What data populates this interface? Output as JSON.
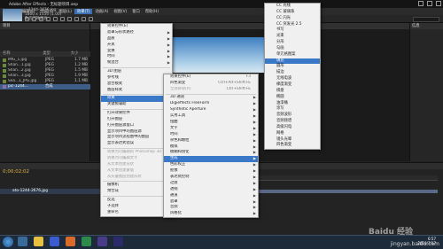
{
  "app": {
    "title": "Adobe After Effects - 无标题项目.aep",
    "menus": [
      "文件(F)",
      "编辑(E)",
      "合成(C)",
      "图层(L)",
      "效果(T)",
      "动画(A)",
      "视图(V)",
      "窗口",
      "帮助(H)"
    ],
    "active_menu": 4
  },
  "project": {
    "header": "项目",
    "info": [
      "...1244-2676.jpg",
      "1800 x 1150 (1.00)",
      "数百万种颜色"
    ],
    "columns": [
      "名称",
      "类型",
      "大小"
    ],
    "files": [
      {
        "name": "IMG_1.jpg",
        "type": "JPEG",
        "size": "1.7 MB"
      },
      {
        "name": "Shan...1.jpg",
        "type": "JPEG",
        "size": "1.2 MB"
      },
      {
        "name": "Shan...2.jpg",
        "type": "JPEG",
        "size": "1.5 MB"
      },
      {
        "name": "Shan...3.jpg",
        "type": "JPEG",
        "size": "1.9 MB"
      },
      {
        "name": "Sea...1_JPG.jpg",
        "type": "JPEG",
        "size": "1.1 MB"
      },
      {
        "name": "pic-1244...",
        "type": "合成",
        "size": ""
      }
    ]
  },
  "right_panel": {
    "header": "信息"
  },
  "timeline": {
    "timecode": "0;00;02;02",
    "layer": "ato-1244-2676.jpg"
  },
  "effect_menu": [
    {
      "label": "效果控件(E)",
      "arrow": false,
      "dis": false
    },
    {
      "label": "遮罩与形状路径",
      "arrow": true
    },
    {
      "label": "品质",
      "arrow": true
    },
    {
      "label": "开关",
      "arrow": true
    },
    {
      "label": "变换",
      "arrow": true
    },
    {
      "label": "时间",
      "arrow": true
    },
    {
      "label": "帧混合",
      "arrow": true
    },
    {
      "sep": true
    },
    {
      "label": "3D 图层",
      "arrow": false
    },
    {
      "label": "参考线",
      "arrow": false
    },
    {
      "label": "混合模式",
      "arrow": true
    },
    {
      "label": "图层样式",
      "arrow": true
    },
    {
      "sep": true
    },
    {
      "label": "效果",
      "arrow": true,
      "hl": true
    },
    {
      "label": "关键帧辅助",
      "arrow": true
    },
    {
      "sep": true
    },
    {
      "label": "打开效果控件",
      "arrow": false
    },
    {
      "label": "打开图层",
      "arrow": false
    },
    {
      "label": "打开图层源窗口",
      "arrow": false
    },
    {
      "label": "显示项目中的图层源",
      "arrow": false
    },
    {
      "label": "显示项目流程图中的图层",
      "arrow": false
    },
    {
      "label": "显示表达式错误",
      "arrow": false
    },
    {
      "sep": true
    },
    {
      "label": "转换为可编辑的 Photoshop 3D",
      "arrow": false,
      "dis": true
    },
    {
      "label": "转换为可编辑文字",
      "arrow": false,
      "dis": true
    },
    {
      "label": "从文本创建形状",
      "arrow": false,
      "dis": true
    },
    {
      "label": "从文本创建蒙版",
      "arrow": false,
      "dis": true
    },
    {
      "label": "从矢量图层创建形状",
      "arrow": false,
      "dis": true
    },
    {
      "sep": true
    },
    {
      "label": "摄像机",
      "arrow": true
    },
    {
      "label": "预合成",
      "arrow": false
    },
    {
      "sep": true
    },
    {
      "label": "反选",
      "arrow": false
    },
    {
      "label": "子选择",
      "arrow": true
    },
    {
      "label": "重命名",
      "arrow": false
    }
  ],
  "effects_submenu": [
    {
      "label": "效果控件(E)",
      "sc": "F3"
    },
    {
      "label": "四色渐变",
      "sc": "Ctrl+Alt+Shift+E"
    },
    {
      "label": "全部移除(R)",
      "sc": "Ctrl+Shift+E",
      "dis": true
    },
    {
      "sep": true
    },
    {
      "label": "3D 通道",
      "arrow": true
    },
    {
      "label": "Digieffects FreeForm",
      "arrow": true
    },
    {
      "label": "Synthetic Aperture",
      "arrow": true
    },
    {
      "label": "实用工具",
      "arrow": true
    },
    {
      "label": "扭曲",
      "arrow": true
    },
    {
      "label": "文字",
      "arrow": true
    },
    {
      "label": "时间",
      "arrow": true
    },
    {
      "label": "杂色和颗粒",
      "arrow": true
    },
    {
      "label": "模拟",
      "arrow": true
    },
    {
      "label": "模糊和锐化",
      "arrow": true
    },
    {
      "label": "生成",
      "arrow": true,
      "hl": true
    },
    {
      "label": "色彩校正",
      "arrow": true
    },
    {
      "label": "抠像",
      "arrow": true
    },
    {
      "label": "表达式控制",
      "arrow": true
    },
    {
      "label": "过渡",
      "arrow": true
    },
    {
      "label": "透视",
      "arrow": true
    },
    {
      "label": "通道",
      "arrow": true
    },
    {
      "label": "遮罩",
      "arrow": true
    },
    {
      "label": "音频",
      "arrow": true
    },
    {
      "label": "风格化",
      "arrow": true
    }
  ],
  "generate_submenu": [
    {
      "label": "CC 光线"
    },
    {
      "label": "CC 玻璃珠"
    },
    {
      "label": "CC 闪光"
    },
    {
      "label": "CC 突发光 2.5"
    },
    {
      "label": "书写"
    },
    {
      "label": "光束"
    },
    {
      "label": "分形"
    },
    {
      "label": "勾画"
    },
    {
      "label": "单元格图案"
    },
    {
      "label": "填充"
    },
    {
      "label": "圆形"
    },
    {
      "label": "描边"
    },
    {
      "label": "无线电波"
    },
    {
      "label": "梯度渐变"
    },
    {
      "label": "棋盘"
    },
    {
      "label": "椭圆"
    },
    {
      "label": "油漆桶"
    },
    {
      "label": "涂写"
    },
    {
      "label": "音频波形"
    },
    {
      "label": "音频频谱"
    },
    {
      "label": "高级闪电"
    },
    {
      "label": "网格"
    },
    {
      "label": "镜头光晕"
    },
    {
      "label": "四色渐变"
    }
  ],
  "taskbar": {
    "time": "6:57",
    "date": "2019/7/17"
  },
  "watermark": {
    "text": "Baidu 经验",
    "url": "jingyan.baidu.com"
  }
}
